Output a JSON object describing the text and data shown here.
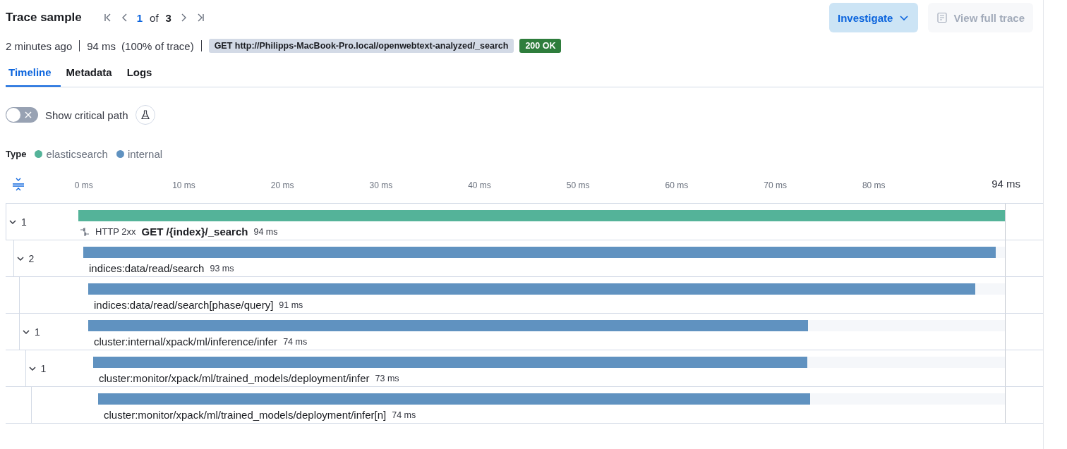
{
  "header": {
    "title": "Trace sample",
    "pagination": {
      "current": "1",
      "of": "of",
      "total": "3"
    },
    "buttons": [
      {
        "label": "Investigate",
        "kind": "dropdown",
        "disabled": false
      },
      {
        "label": "View full trace",
        "kind": "document",
        "disabled": true
      }
    ]
  },
  "summary": {
    "time": "2 minutes ago",
    "duration": "94 ms",
    "percent": "(100% of trace)",
    "request": "GET http://Philipps-MacBook-Pro.local/openwebtext-analyzed/_search",
    "status": "200 OK"
  },
  "tabs": [
    {
      "label": "Timeline",
      "selected": true
    },
    {
      "label": "Metadata",
      "selected": false
    },
    {
      "label": "Logs",
      "selected": false
    }
  ],
  "critical_path": {
    "label": "Show critical path",
    "on": false
  },
  "legend": {
    "label": "Type",
    "items": [
      {
        "name": "elasticsearch",
        "color": "#54b399"
      },
      {
        "name": "internal",
        "color": "#6092c0"
      }
    ]
  },
  "timeline": {
    "ticks": [
      "0 ms",
      "10 ms",
      "20 ms",
      "30 ms",
      "40 ms",
      "50 ms",
      "60 ms",
      "70 ms",
      "80 ms"
    ],
    "end_label": "94 ms",
    "spans": [
      {
        "count": "1",
        "expanded": true,
        "status": "HTTP 2xx",
        "name": "GET /{index}/_search",
        "duration": "94 ms",
        "color": "#54b399",
        "level": 1,
        "children": [
          {
            "count": "2",
            "expanded": true,
            "name": "indices:data/read/search",
            "duration": "93 ms",
            "color": "#6092c0",
            "level": 0.99,
            "children": [
              {
                "name": "indices:data/read/search[phase/query]",
                "duration": "91 ms",
                "color": "#6092c0",
                "level": 0.968
              },
              {
                "count": "1",
                "expanded": true,
                "name": "cluster:internal/xpack/ml/inference/infer",
                "duration": "74 ms",
                "color": "#6092c0",
                "level": 0.785,
                "children": [
                  {
                    "count": "1",
                    "expanded": true,
                    "name": "cluster:monitor/xpack/ml/trained_models/deployment/infer",
                    "duration": "73 ms",
                    "color": "#6092c0",
                    "level": 0.783,
                    "children": [
                      {
                        "name": "cluster:monitor/xpack/ml/trained_models/deployment/infer[n]",
                        "duration": "74 ms",
                        "color": "#6092c0",
                        "level": 0.785
                      }
                    ]
                  }
                ]
              }
            ]
          }
        ]
      }
    ]
  }
}
